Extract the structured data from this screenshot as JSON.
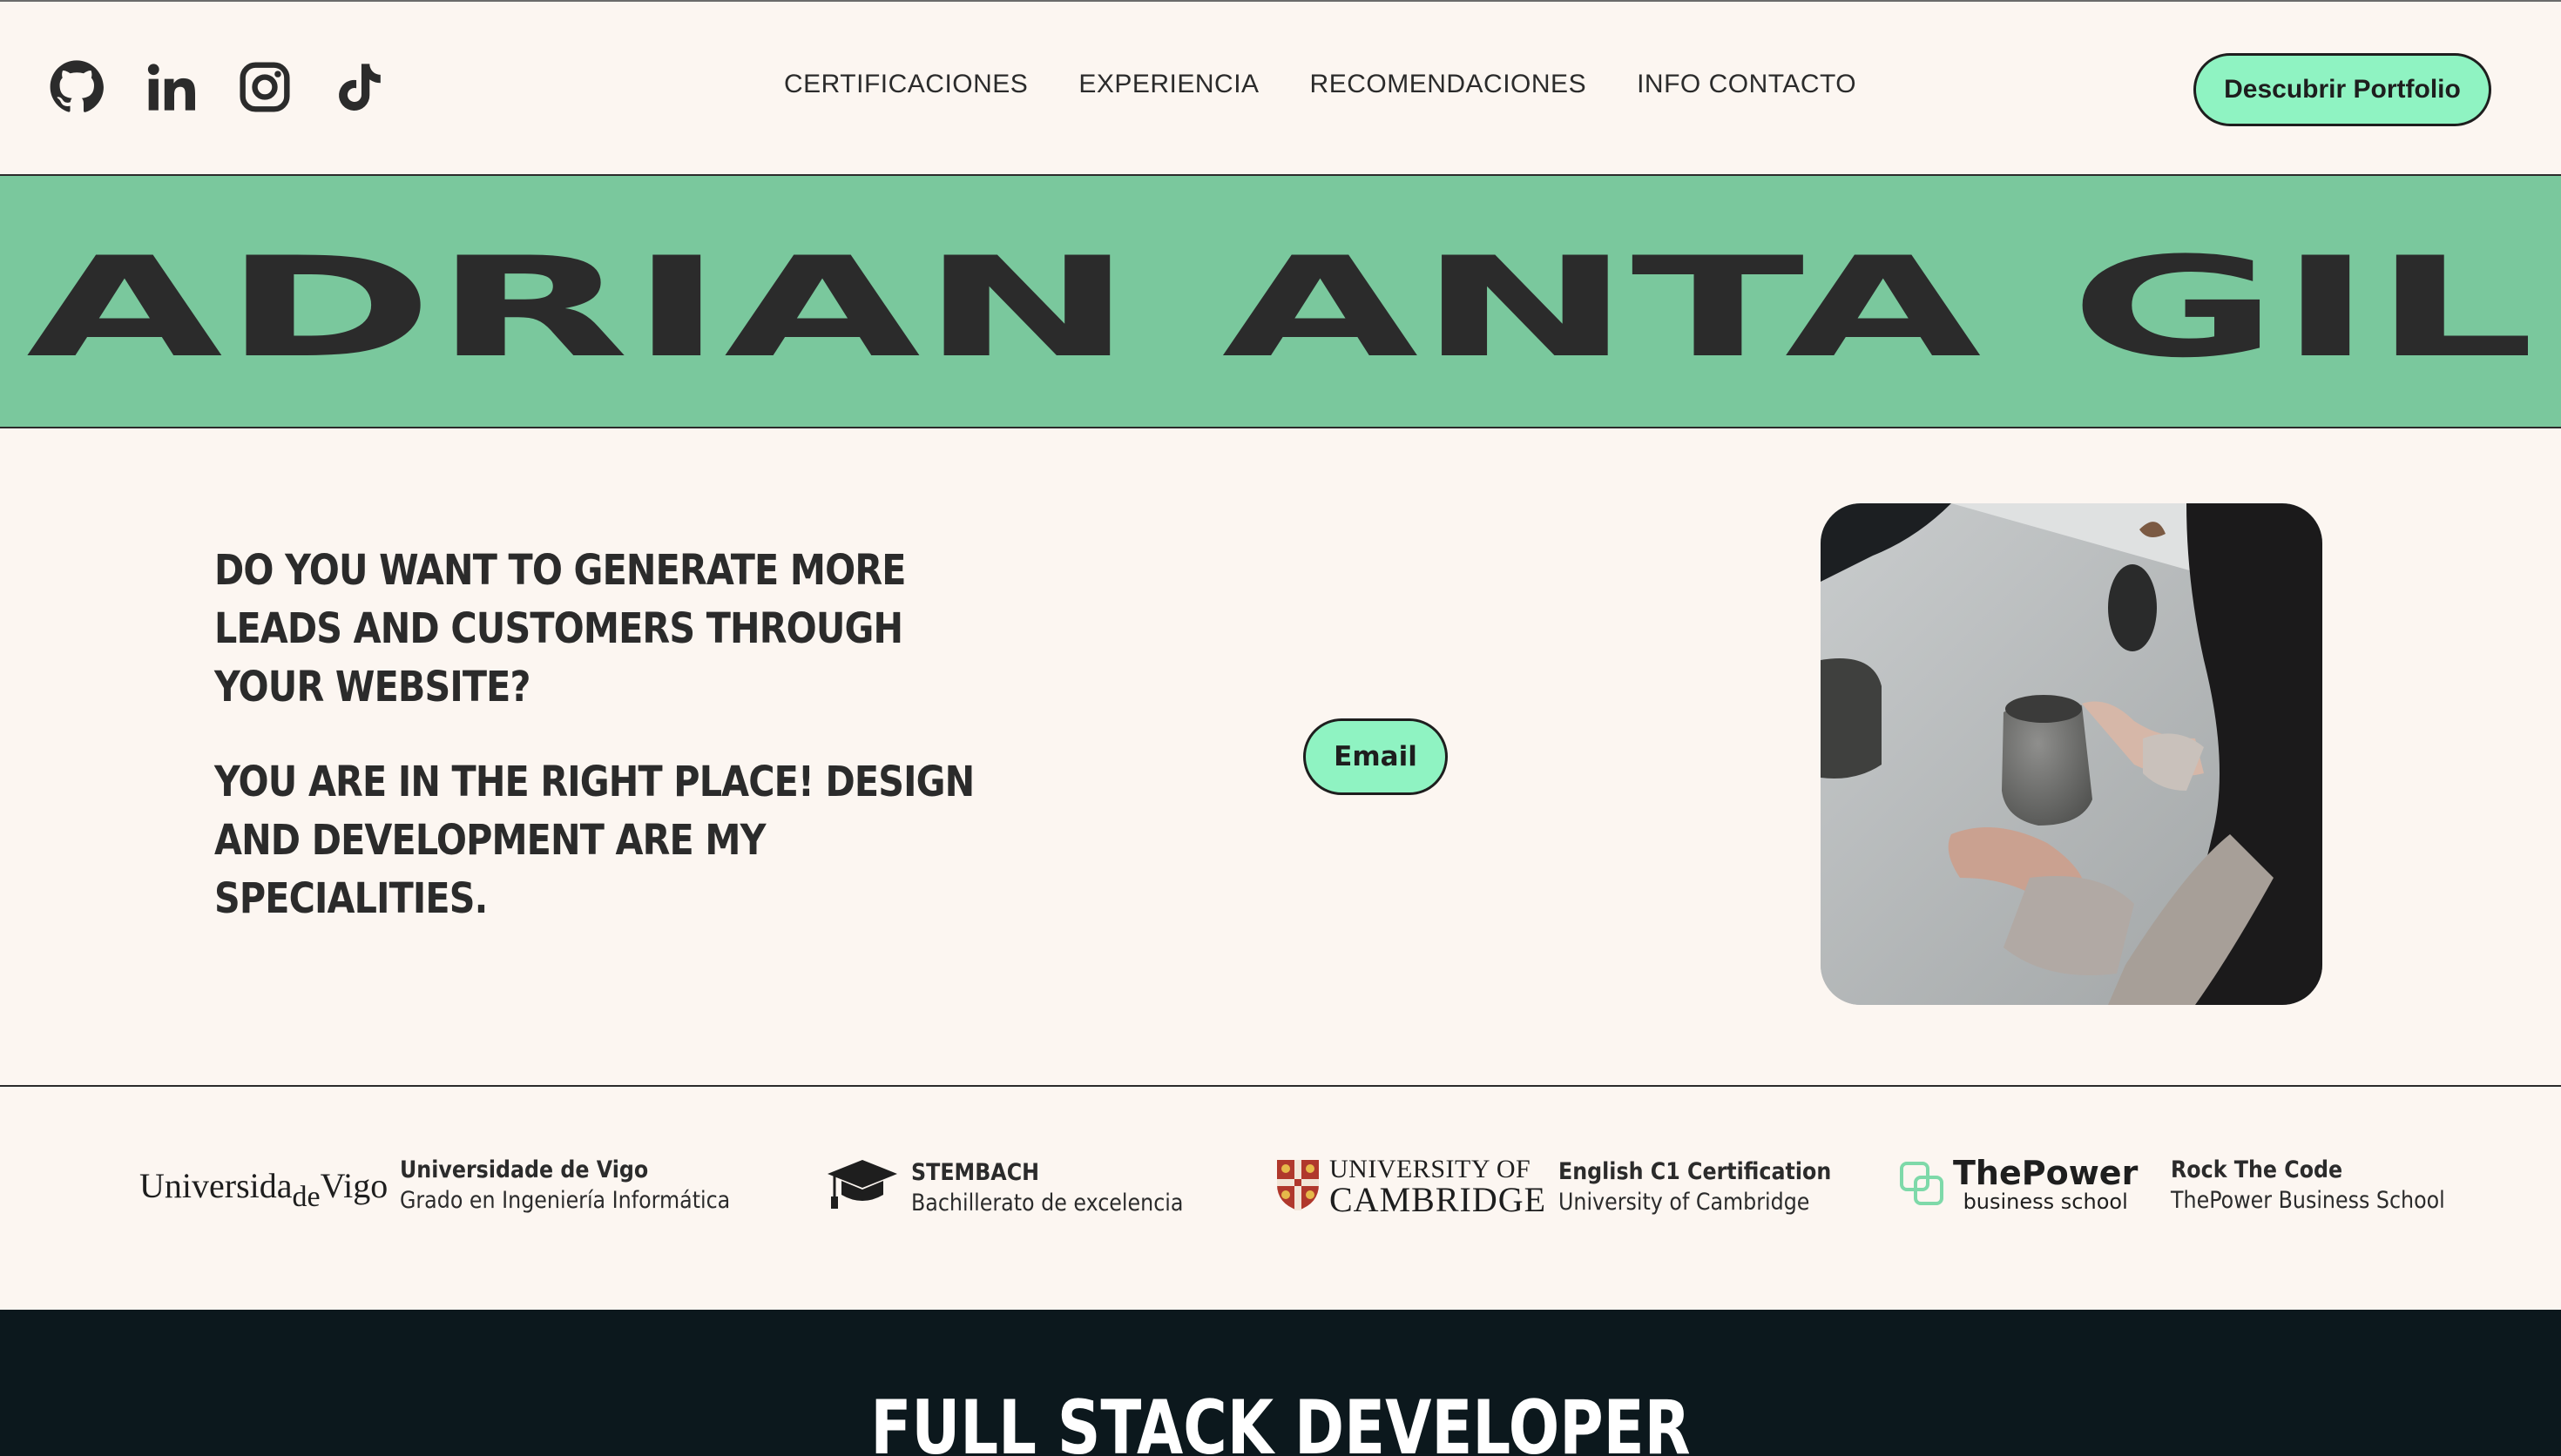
{
  "header": {
    "socials": [
      {
        "icon": "github-icon"
      },
      {
        "icon": "linkedin-icon"
      },
      {
        "icon": "instagram-icon"
      },
      {
        "icon": "tiktok-icon"
      }
    ],
    "nav": [
      {
        "label": "CERTIFICACIONES"
      },
      {
        "label": "EXPERIENCIA"
      },
      {
        "label": "RECOMENDACIONES"
      },
      {
        "label": "INFO CONTACTO"
      }
    ],
    "cta_label": "Descubrir Portfolio"
  },
  "banner": {
    "name": "ADRIAN ANTA GIL",
    "color": "#7ac89d"
  },
  "hero": {
    "line1": "DO YOU WANT TO GENERATE MORE LEADS AND CUSTOMERS THROUGH YOUR WEBSITE?",
    "line2": "YOU ARE IN THE RIGHT PLACE! DESIGN AND DEVELOPMENT ARE MY SPECIALITIES.",
    "email_label": "Email"
  },
  "credentials": [
    {
      "logo_text": "UniversidadeVigo",
      "title": "Universidade de Vigo",
      "subtitle": "Grado en Ingeniería Informática"
    },
    {
      "logo_icon": "graduation-cap-icon",
      "title": "STEMBACH",
      "subtitle": "Bachillerato de excelencia"
    },
    {
      "logo_line1": "UNIVERSITY OF",
      "logo_line2": "CAMBRIDGE",
      "title": "English C1 Certification",
      "subtitle": "University of Cambridge"
    },
    {
      "logo_line1": "ThePower",
      "logo_line2": "business school",
      "title": "Rock The Code",
      "subtitle": "ThePower Business School"
    }
  ],
  "section": {
    "title": "FULL STACK DEVELOPER"
  },
  "colors": {
    "accent": "#8ff3c2",
    "banner": "#7ac89d",
    "background": "#fcf6f1",
    "dark": "#0c181d"
  }
}
